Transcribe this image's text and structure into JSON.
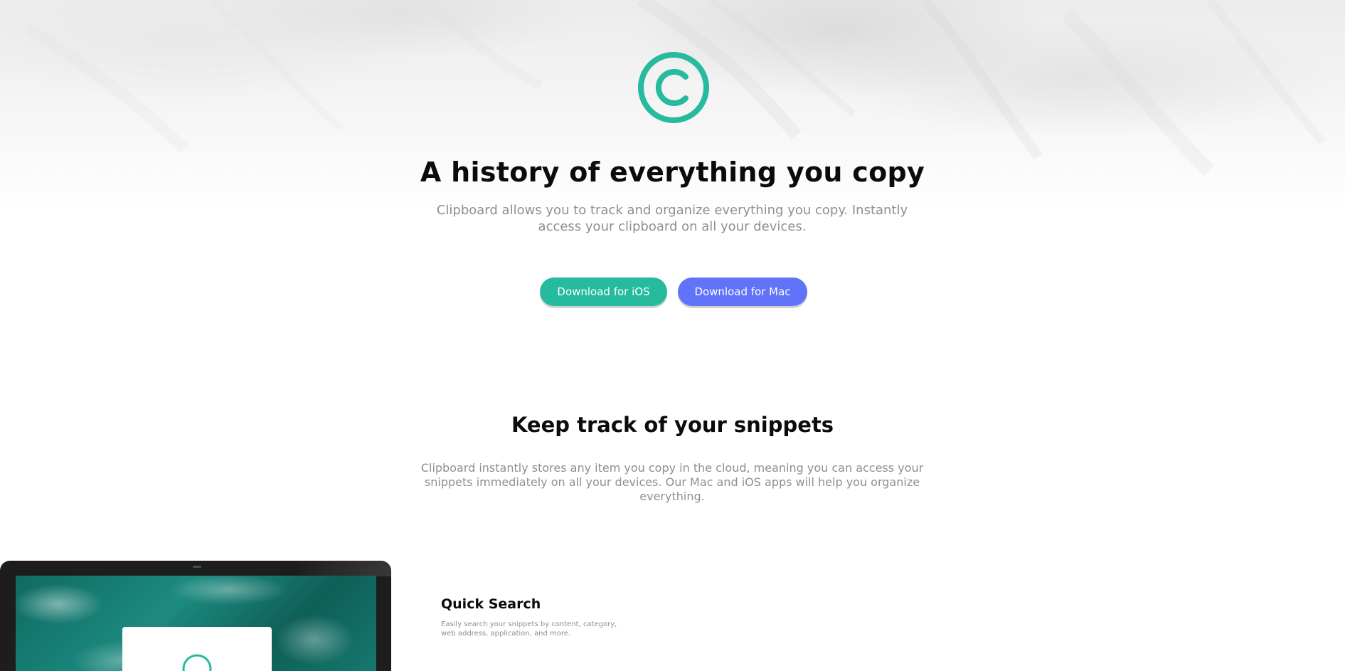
{
  "hero": {
    "logo_icon": "copyright-icon",
    "title": "A history of everything you copy",
    "subtitle": "Clipboard allows you to track and organize everything you copy. Instantly access your clipboard on all your devices.",
    "buttons": {
      "ios": "Download for iOS",
      "mac": "Download for Mac"
    }
  },
  "snippets": {
    "title": "Keep track of your snippets",
    "description": "Clipboard instantly stores any item you copy in the cloud, meaning you can access your snippets immediately on all your devices. Our Mac and iOS apps will help you organize everything."
  },
  "features": [
    {
      "title": "Quick Search",
      "description": "Easily search your snippets by content, category, web address, application, and more."
    }
  ],
  "colors": {
    "accent_teal": "#26ba9f",
    "accent_blue": "#6173f8",
    "heading": "#0b0b0b",
    "body_text": "#8c8f94"
  }
}
